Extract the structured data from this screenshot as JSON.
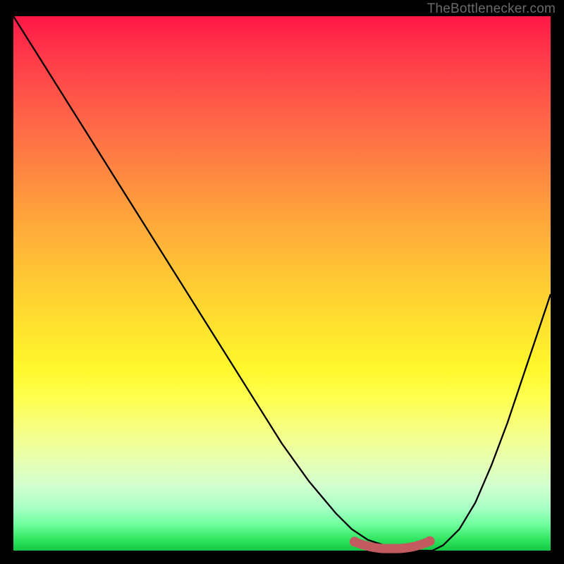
{
  "watermark": "TheBottlenecker.com",
  "chart_data": {
    "type": "line",
    "title": "",
    "xlabel": "",
    "ylabel": "",
    "xlim": [
      0,
      100
    ],
    "ylim": [
      0,
      100
    ],
    "series": [
      {
        "name": "curve",
        "x": [
          0,
          5,
          10,
          15,
          20,
          25,
          30,
          35,
          40,
          45,
          50,
          55,
          60,
          63,
          66,
          69,
          72,
          75,
          78,
          80,
          83,
          86,
          89,
          92,
          95,
          98,
          100
        ],
        "values": [
          100,
          92,
          84,
          76,
          68,
          60,
          52,
          44,
          36,
          28,
          20,
          13,
          7,
          4,
          2,
          1,
          0,
          0,
          0,
          1,
          4,
          9,
          16,
          24,
          33,
          42,
          48
        ]
      }
    ],
    "markers": [
      {
        "name": "flat-segment-left",
        "x": 63.5,
        "y": 1.8
      },
      {
        "name": "flat-segment-right",
        "x": 77.5,
        "y": 1.9
      }
    ],
    "colors": {
      "curve": "#000000",
      "marker": "#c25a5f",
      "marker_border": "#9e4448"
    }
  }
}
